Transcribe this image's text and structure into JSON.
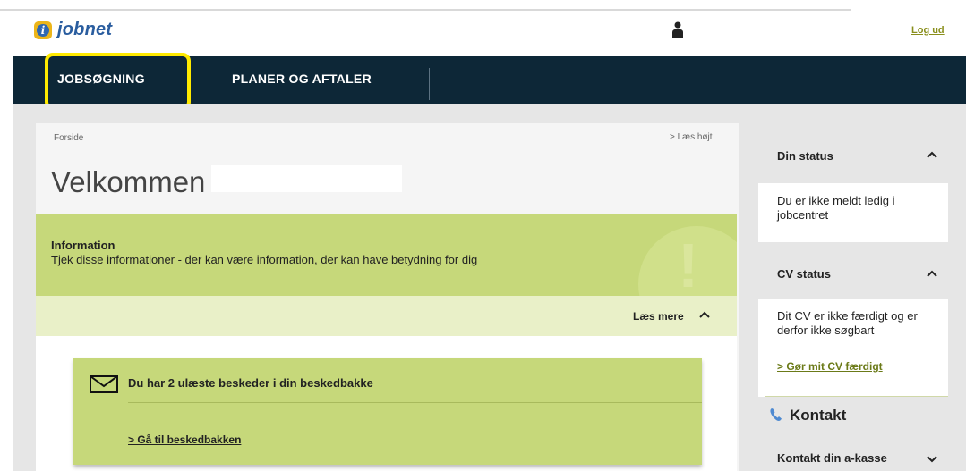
{
  "header": {
    "logo_letter": "i",
    "logo_text": "jobnet",
    "login_label": "Log ud",
    "user_icon": "user-icon"
  },
  "nav": {
    "items": [
      {
        "label": "JOBSØGNING"
      },
      {
        "label": "PLANER OG AFTALER"
      }
    ]
  },
  "main": {
    "breadcrumb": "Forside",
    "read_aloud": "> Læs højt",
    "welcome": "Velkommen",
    "info": {
      "title": "Information",
      "text": "Tjek disse informationer - der kan være information, der kan have betydning for dig",
      "mark": "!",
      "read_more": "Læs mere"
    },
    "messages": {
      "text": "Du har 2 ulæste beskeder i din beskedbakke",
      "link": "> Gå til beskedbakken",
      "icon": "envelope-icon"
    }
  },
  "sidebar": {
    "status": {
      "title": "Din status",
      "text": "Du er ikke meldt ledig i jobcentret"
    },
    "cv": {
      "title": "CV status",
      "text": "Dit CV er ikke færdigt og er derfor ikke søgbart",
      "link": "> Gør mit CV færdigt"
    },
    "contact": {
      "title": "Kontakt",
      "akasse": "Kontakt din a-kasse",
      "icon": "phone-icon"
    }
  },
  "colors": {
    "nav_bg": "#0d2737",
    "highlight": "#ffea00",
    "info_green": "#c6d87a",
    "page_gray": "#e6e6e6"
  }
}
